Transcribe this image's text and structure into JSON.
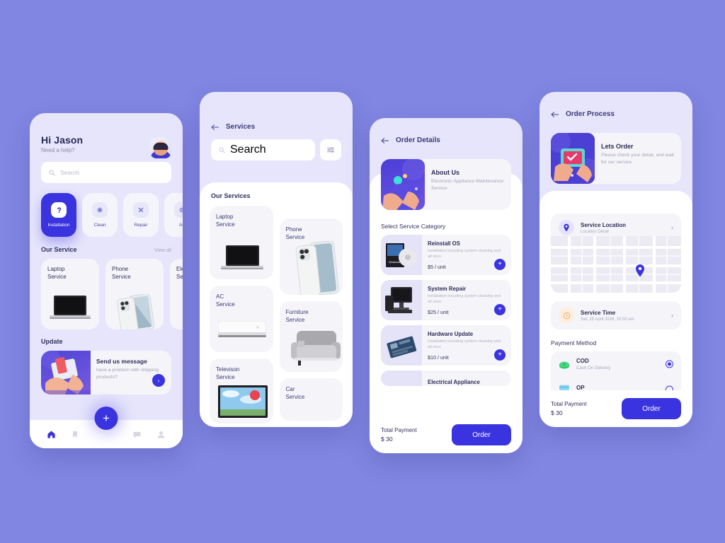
{
  "meta": {
    "background_color": "#8186e3",
    "accent_color": "#3a33e0",
    "phone_bg": "#e6e5fb",
    "card_bg": "#f5f5f9"
  },
  "screen_home": {
    "greeting": "Hi Jason",
    "subtitle": "Need a help?",
    "avatar_name": "user-avatar",
    "search_placeholder": "Search",
    "categories": [
      {
        "label": "Installation",
        "icon": "installation-icon",
        "active": true
      },
      {
        "label": "Clean",
        "icon": "clean-icon",
        "active": false
      },
      {
        "label": "Repair",
        "icon": "repair-icon",
        "active": false
      },
      {
        "label": "Au",
        "icon": "audit-icon",
        "active": false
      }
    ],
    "section_title": "Our Service",
    "section_link": "View all",
    "services": [
      {
        "title": "Laptop\nService",
        "image": "laptop-image"
      },
      {
        "title": "Phone\nService",
        "image": "phone-image"
      },
      {
        "title": "Ele\nSe",
        "image": "electronic-image"
      }
    ],
    "update_title": "Update",
    "update_card": {
      "heading": "Send us message",
      "subtext": "have a problem with shipping products?",
      "arrow": "›"
    },
    "fab_label": "+",
    "tabs": [
      {
        "name": "home-tab",
        "icon": "home-icon",
        "active": true
      },
      {
        "name": "bookmark-tab",
        "icon": "bookmark-icon",
        "active": false
      },
      {
        "name": "chat-tab",
        "icon": "chat-icon",
        "active": false
      },
      {
        "name": "profile-tab",
        "icon": "profile-icon",
        "active": false
      }
    ]
  },
  "screen_services": {
    "back_icon": "back-arrow-icon",
    "title": "Services",
    "search_placeholder": "Search",
    "filter_icon": "filter-icon",
    "section_title": "Our Services",
    "left_column": [
      {
        "title": "Laptop\nService",
        "image": "laptop-image"
      },
      {
        "title": "AC\nService",
        "image": "ac-image"
      },
      {
        "title": "Televison\nService",
        "image": "tv-image"
      }
    ],
    "right_column": [
      {
        "title": "Phone\nService",
        "image": "phone-image"
      },
      {
        "title": "Furniture\nService",
        "image": "sofa-image"
      },
      {
        "title": "Car\nService",
        "image": "car-image"
      }
    ]
  },
  "screen_order_details": {
    "back_icon": "back-arrow-icon",
    "title": "Order Details",
    "about": {
      "heading": "About Us",
      "subtext": "Electronic Appliance Maintenance Service",
      "image": "about-illustration"
    },
    "category_title": "Select Service Category",
    "items": [
      {
        "name": "Reinstall OS",
        "description": "Installation including system cleaning and all virus",
        "price": "$5 / unit",
        "image": "os-disc-image",
        "add_label": "+"
      },
      {
        "name": "System Repair",
        "description": "Installation including system cleaning and all virus",
        "price": "$25 / unit",
        "image": "desktop-pc-image",
        "add_label": "+"
      },
      {
        "name": "Hardware Update",
        "description": "Installation including system cleaning and all virus",
        "price": "$10 / unit",
        "image": "motherboard-image",
        "add_label": "+"
      },
      {
        "name": "Electrical Appliance",
        "description": "",
        "price": "",
        "image": "appliance-image",
        "add_label": "+"
      }
    ],
    "footer": {
      "total_label": "Total Payment",
      "total_amount": "$ 30",
      "order_button": "Order"
    }
  },
  "screen_order_process": {
    "back_icon": "back-arrow-icon",
    "title": "Order Process",
    "hero": {
      "heading": "Lets Order",
      "subtext": "Please check your detail, and wait for our service.",
      "image": "lets-order-illustration"
    },
    "location": {
      "icon": "location-pin-icon",
      "heading": "Service Location",
      "subtext": "Location Detail",
      "chevron": "›",
      "map_pin": "map-pin-icon"
    },
    "time": {
      "icon": "clock-icon",
      "heading": "Service Time",
      "subtext": "Sat, 29 April 2026, 10:00 am",
      "chevron": "›"
    },
    "payment_title": "Payment Method",
    "payment_methods": [
      {
        "name": "COD",
        "subtext": "Cash On Delivery",
        "icon": "cash-icon",
        "selected": true
      },
      {
        "name": "OP",
        "subtext": "",
        "icon": "online-payment-icon",
        "selected": false
      }
    ],
    "footer": {
      "total_label": "Total Payment",
      "total_amount": "$ 30",
      "order_button": "Order"
    }
  }
}
